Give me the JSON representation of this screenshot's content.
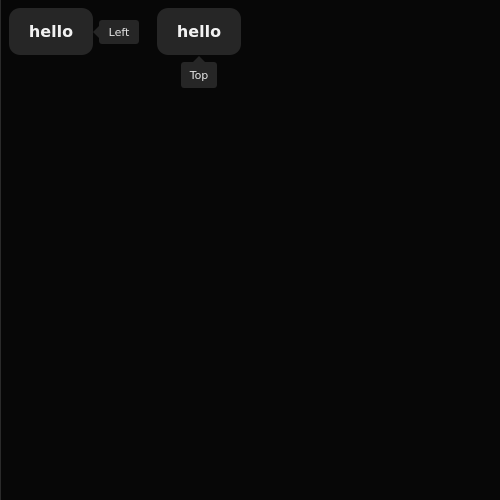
{
  "buttons": [
    {
      "label": "hello",
      "tooltip": "Left"
    },
    {
      "label": "hello",
      "tooltip": "Top"
    }
  ],
  "colors": {
    "background": "#070707",
    "button": "#262626",
    "button_text": "#f2f2f2",
    "tooltip": "#262626",
    "tooltip_text": "#e0e0e0"
  }
}
